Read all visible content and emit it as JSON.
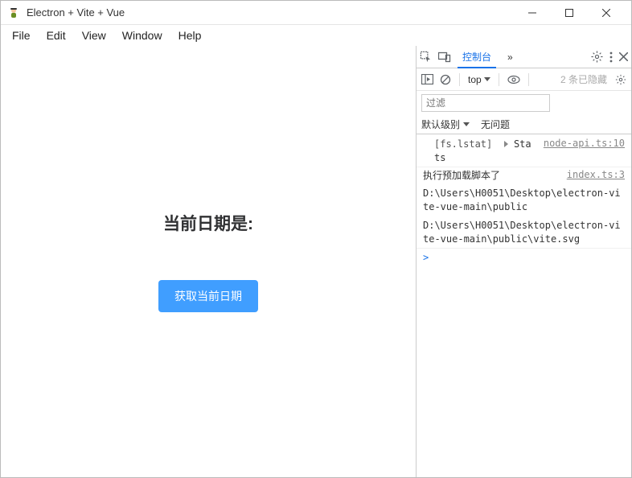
{
  "window": {
    "title": "Electron + Vite + Vue"
  },
  "menubar": {
    "file": "File",
    "edit": "Edit",
    "view": "View",
    "window": "Window",
    "help": "Help"
  },
  "app": {
    "heading": "当前日期是:",
    "button_label": "获取当前日期"
  },
  "devtools": {
    "tabs": {
      "console": "控制台",
      "more": "»"
    },
    "toolbar": {
      "context_label": "top",
      "hidden_msg": "2 条已隐藏"
    },
    "filter": {
      "placeholder": "过滤"
    },
    "level": {
      "default": "默认级别",
      "no_issues": "无问题"
    },
    "console": {
      "entries": [
        {
          "prefix": "[fs.lstat]",
          "object": "Stats",
          "source": "node-api.ts:10"
        },
        {
          "headline": "执行预加载脚本了",
          "source": "index.ts:3",
          "lines": [
            "D:\\Users\\H0051\\Desktop\\electron-vite-vue-main\\public",
            "D:\\Users\\H0051\\Desktop\\electron-vite-vue-main\\public\\vite.svg"
          ]
        }
      ],
      "prompt": ">"
    }
  }
}
